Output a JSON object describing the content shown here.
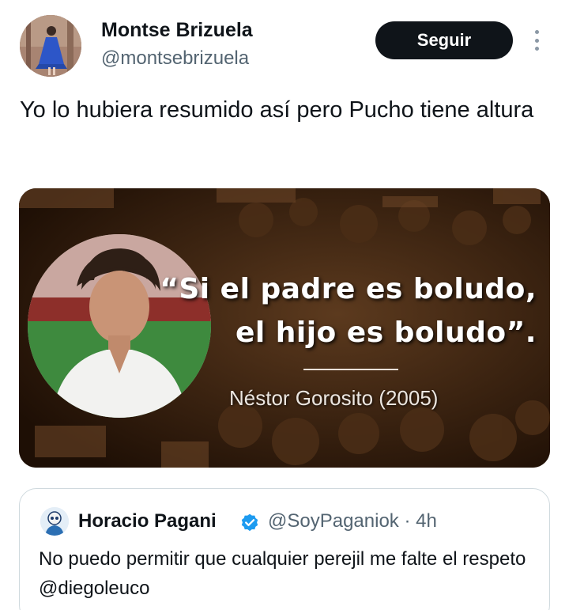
{
  "author": {
    "name": "Montse Brizuela",
    "handle": "@montsebrizuela",
    "avatar_icon": "avatar-photo"
  },
  "actions": {
    "follow_label": "Seguir",
    "more_icon": "more-vertical-icon"
  },
  "tweet": {
    "text": "Yo lo hubiera resumido así pero Pucho tiene altura"
  },
  "media": {
    "quote_line_1": "“Si el padre es boludo,",
    "quote_line_2": "el hijo es boludo”.",
    "quote_author": "Néstor Gorosito (2005)"
  },
  "quoted_tweet": {
    "name": "Horacio Pagani",
    "handle_time": "@SoyPaganiok · 4h",
    "text": "No puedo permitir que cualquier perejil me falte el respeto @diegoleuco",
    "verified_color": "#1d9bf0"
  },
  "colors": {
    "text_primary": "#0f1419",
    "text_secondary": "#536471",
    "button_bg": "#0f1419",
    "border": "#cfd9de"
  }
}
